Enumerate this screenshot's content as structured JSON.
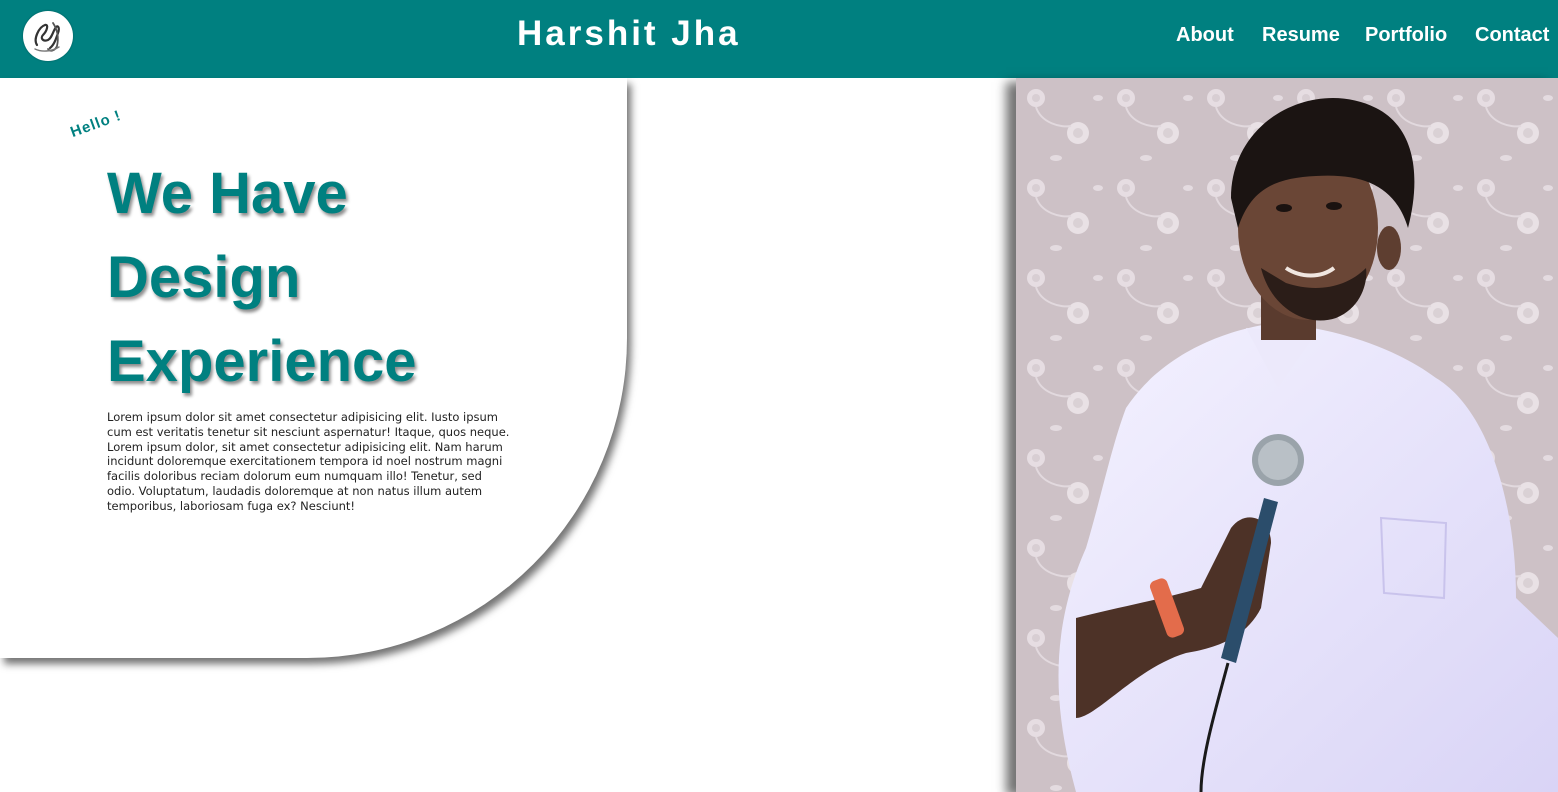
{
  "header": {
    "logo": "hj-signature-logo",
    "brand": "Harshit Jha",
    "nav": [
      "About",
      "Resume",
      "Portfolio",
      "Contact"
    ],
    "background": "#008080"
  },
  "hero": {
    "greeting": "Hello !",
    "headline": [
      "We Have",
      "Design",
      "Experience"
    ],
    "body": "Lorem ipsum dolor sit amet consectetur adipisicing elit. Iusto ipsum cum est veritatis tenetur sit nesciunt aspernatur! Itaque, quos neque. Lorem ipsum dolor, sit amet consectetur adipisicing elit. Nam harum incidunt doloremque exercitationem tempora id noel nostrum magni facilis doloribus reciam dolorum eum numquam illo! Tenetur, sed odio. Voluptatum, laudadis doloremque at non natus illum autem temporibus, laboriosam fuga ex? Nesciunt!",
    "accent": "#008080"
  },
  "photo": {
    "subject": "portrait-man-holding-microphone"
  }
}
